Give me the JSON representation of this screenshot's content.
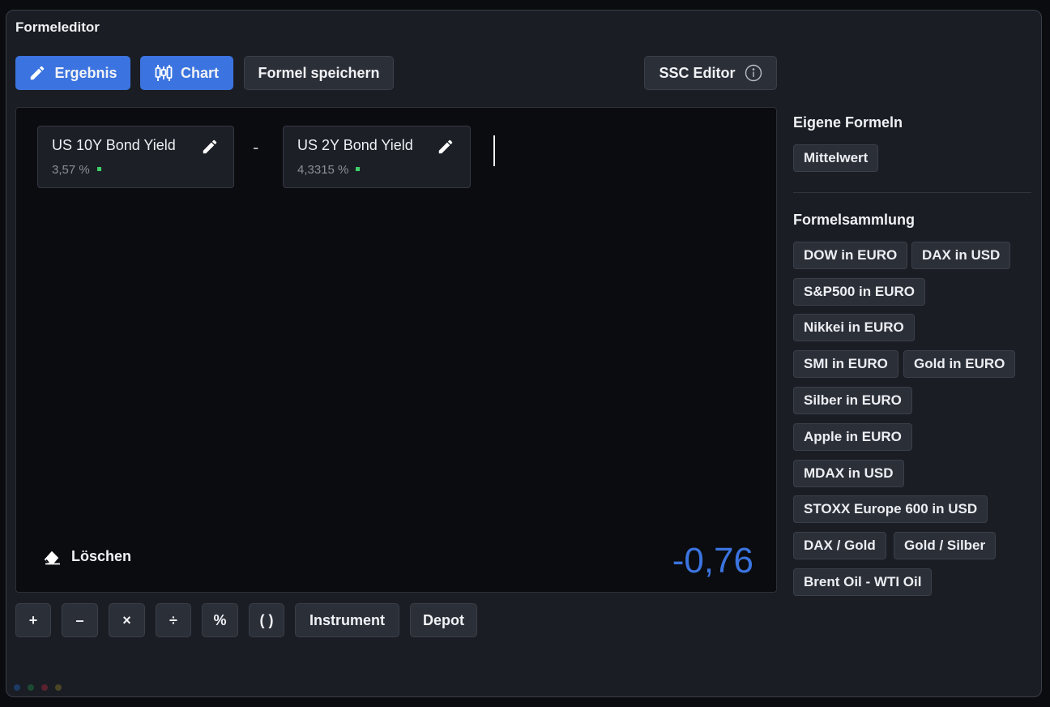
{
  "window": {
    "title": "Formeleditor"
  },
  "toolbar": {
    "result_label": "Ergebnis",
    "chart_label": "Chart",
    "save_label": "Formel speichern",
    "ssc_label": "SSC Editor"
  },
  "formula": {
    "operands": [
      {
        "name": "US 10Y Bond Yield",
        "value": "3,57 %"
      },
      {
        "name": "US 2Y Bond Yield",
        "value": "4,3315 %"
      }
    ],
    "operator": "-",
    "clear_label": "Löschen",
    "result": "-0,76"
  },
  "keypad": {
    "plus": "+",
    "minus": "–",
    "times": "×",
    "divide": "÷",
    "percent": "%",
    "parens": "( )",
    "instrument": "Instrument",
    "depot": "Depot"
  },
  "sidebar": {
    "own_title": "Eigene Formeln",
    "own_items": [
      "Mittelwert"
    ],
    "collection_title": "Formelsammlung",
    "collection_items": [
      "DOW in EURO",
      "DAX in USD",
      "S&P500 in EURO",
      "Nikkei in EURO",
      "SMI in EURO",
      "Gold in EURO",
      "Silber in EURO",
      "Apple in EURO",
      "MDAX in USD",
      "STOXX Europe 600 in USD",
      "DAX / Gold",
      "Gold / Silber",
      "Brent Oil - WTI Oil"
    ]
  },
  "colors": {
    "accent": "#3b74e0",
    "positive": "#3fd06b",
    "panel": "#1a1d24"
  }
}
